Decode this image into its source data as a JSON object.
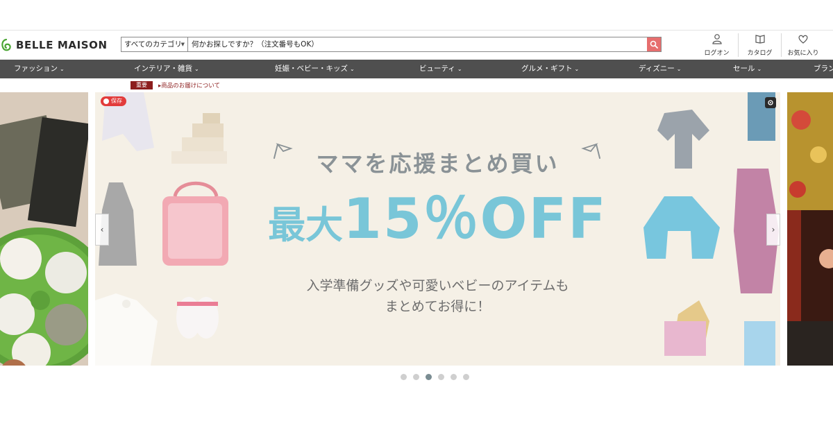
{
  "brand": {
    "name": "BELLE MAISON",
    "color": "#4aa533"
  },
  "search": {
    "category": "すべてのカテゴリ",
    "placeholder": "何かお探しですか？（注文番号もOK）",
    "button_color": "#e66e6e"
  },
  "header_icons": [
    {
      "label": "ログオン",
      "icon": "user-icon"
    },
    {
      "label": "カタログ",
      "icon": "book-icon"
    },
    {
      "label": "お気に入り",
      "icon": "heart-icon"
    }
  ],
  "nav": {
    "items": [
      {
        "label": "ファッション"
      },
      {
        "label": "インテリア・雑貨"
      },
      {
        "label": "妊娠・ベビー・キッズ"
      },
      {
        "label": "ビューティ"
      },
      {
        "label": "グルメ・ギフト"
      },
      {
        "label": "ディズニー"
      },
      {
        "label": "セール"
      },
      {
        "label": "ブラン"
      }
    ],
    "background": "#4f4f4f"
  },
  "notice": {
    "badge": "重要",
    "link": "商品のお届けについて"
  },
  "carousel": {
    "save_label": "保存",
    "headline": "ママを応援まとめ買い",
    "big_prefix": "最大",
    "big_value": "15％OFF",
    "sub_line1": "入学準備グッズや可愛いベビーのアイテムも",
    "sub_line2": "まとめてお得に！",
    "slide_count": 6,
    "active_index": 2,
    "accent_color": "#79c6d8"
  }
}
